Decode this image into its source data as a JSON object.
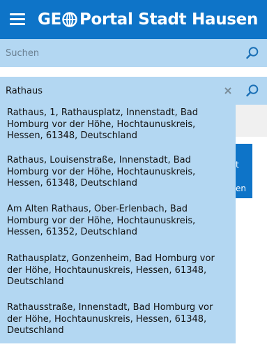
{
  "header": {
    "logo_prefix": "GE",
    "logo_rest": "Portal Stadt Hausen",
    "menu_icon": "hamburger-menu-icon",
    "globe_icon": "globe-icon"
  },
  "search_main": {
    "placeholder": "Suchen",
    "icon": "search-icon"
  },
  "search_address": {
    "value": "Rathaus",
    "clear_icon": "close-icon",
    "icon": "search-icon"
  },
  "suggestions": [
    {
      "text": "Rathaus, 1, Rathausplatz, Innenstadt, Bad Homburg vor der Höhe, Hochtaunuskreis, Hessen, 61348, Deutschland"
    },
    {
      "text": "Rathaus, Louisenstraße, Innenstadt, Bad Homburg vor der Höhe, Hochtaunuskreis, Hessen, 61348, Deutschland"
    },
    {
      "text": "Am Alten Rathaus, Ober-Erlenbach, Bad Homburg vor der Höhe, Hochtaunuskreis, Hessen, 61352, Deutschland"
    },
    {
      "text": "Rathausplatz, Gonzenheim, Bad Homburg vor der Höhe, Hochtaunuskreis, Hessen, 61348, Deutschland"
    },
    {
      "text": "Rathausstraße, Innenstadt, Bad Homburg vor der Höhe, Hochtaunuskreis, Hessen, 61348, Deutschland"
    }
  ],
  "background": {
    "button_text_1": "t",
    "button_text_2": "en"
  },
  "colors": {
    "header": "#0e74c8",
    "search_bg": "#b3d7f2",
    "icon_blue": "#1a6fb5"
  }
}
